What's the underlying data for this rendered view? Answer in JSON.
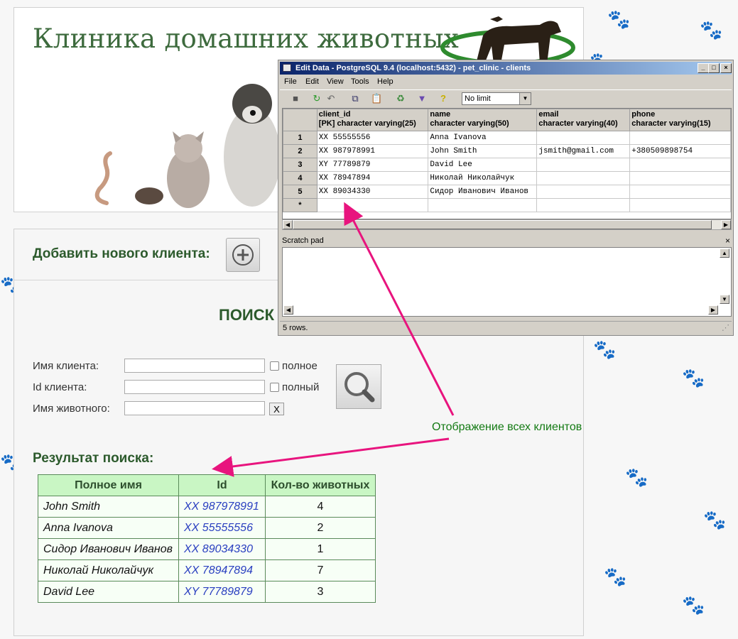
{
  "header": {
    "title": "Клиника домашних животных"
  },
  "main": {
    "add_client_label": "Добавить нового клиента:",
    "search_title": "ПОИСК",
    "filters": {
      "client_name_label": "Имя клиента:",
      "client_name_value": "",
      "full_name_checkbox_label": "полное",
      "client_id_label": "Id клиента:",
      "client_id_value": "",
      "full_id_checkbox_label": "полный",
      "pet_name_label": "Имя животного:",
      "pet_name_value": "",
      "clear_button": "X"
    },
    "result_title": "Результат поиска:",
    "results_headers": [
      "Полное имя",
      "Id",
      "Кол-во животных"
    ],
    "results_rows": [
      [
        "John Smith",
        "XX 987978991",
        "4"
      ],
      [
        "Anna Ivanova",
        "XX 55555556",
        "2"
      ],
      [
        "Сидор Иванович Иванов",
        "XX 89034330",
        "1"
      ],
      [
        "Николай Николайчук",
        "XX 78947894",
        "7"
      ],
      [
        "David Lee",
        "XY 77789879",
        "3"
      ]
    ]
  },
  "pgadmin": {
    "title": "Edit Data - PostgreSQL 9.4 (localhost:5432) - pet_clinic - clients",
    "menu": [
      "File",
      "Edit",
      "View",
      "Tools",
      "Help"
    ],
    "row_limit": "No limit",
    "columns": [
      {
        "name": "client_id",
        "type": "[PK] character varying(25)"
      },
      {
        "name": "name",
        "type": "character varying(50)"
      },
      {
        "name": "email",
        "type": "character varying(40)"
      },
      {
        "name": "phone",
        "type": "character varying(15)"
      }
    ],
    "rows": [
      [
        "1",
        "XX 55555556",
        "Anna Ivanova",
        "",
        ""
      ],
      [
        "2",
        "XX 987978991",
        "John Smith",
        "jsmith@gmail.com",
        "+380509898754"
      ],
      [
        "3",
        "XY 77789879",
        "David Lee",
        "",
        ""
      ],
      [
        "4",
        "XX 78947894",
        "Николай Николайчук",
        "",
        ""
      ],
      [
        "5",
        "XX 89034330",
        "Сидор Иванович Иванов",
        "",
        ""
      ],
      [
        "*",
        "",
        "",
        "",
        ""
      ]
    ],
    "scratch_pad_label": "Scratch pad",
    "status": "5 rows."
  },
  "annotation": {
    "label": "Отображение всех клиентов",
    "color": "#e8147e"
  },
  "colors": {
    "title_green": "#3e6b3e",
    "table_header_bg": "#c9f6c4",
    "link_blue": "#2a3fc0"
  }
}
